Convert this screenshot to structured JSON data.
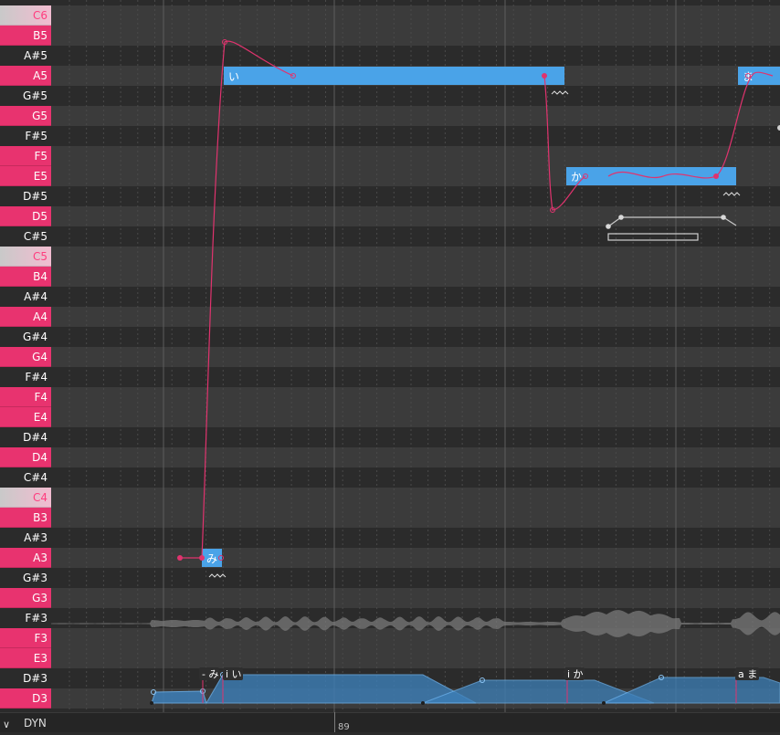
{
  "piano_keys": [
    {
      "label": "C6",
      "kind": "cnote"
    },
    {
      "label": "B5",
      "kind": "white"
    },
    {
      "label": "A#5",
      "kind": "black"
    },
    {
      "label": "A5",
      "kind": "white"
    },
    {
      "label": "G#5",
      "kind": "black"
    },
    {
      "label": "G5",
      "kind": "white"
    },
    {
      "label": "F#5",
      "kind": "black"
    },
    {
      "label": "F5",
      "kind": "white"
    },
    {
      "label": "E5",
      "kind": "white"
    },
    {
      "label": "D#5",
      "kind": "black"
    },
    {
      "label": "D5",
      "kind": "white"
    },
    {
      "label": "C#5",
      "kind": "black"
    },
    {
      "label": "C5",
      "kind": "cnote"
    },
    {
      "label": "B4",
      "kind": "white"
    },
    {
      "label": "A#4",
      "kind": "black"
    },
    {
      "label": "A4",
      "kind": "white"
    },
    {
      "label": "G#4",
      "kind": "black"
    },
    {
      "label": "G4",
      "kind": "white"
    },
    {
      "label": "F#4",
      "kind": "black"
    },
    {
      "label": "F4",
      "kind": "white"
    },
    {
      "label": "E4",
      "kind": "white"
    },
    {
      "label": "D#4",
      "kind": "black"
    },
    {
      "label": "D4",
      "kind": "white"
    },
    {
      "label": "C#4",
      "kind": "black"
    },
    {
      "label": "C4",
      "kind": "cnote"
    },
    {
      "label": "B3",
      "kind": "white"
    },
    {
      "label": "A#3",
      "kind": "black"
    },
    {
      "label": "A3",
      "kind": "white"
    },
    {
      "label": "G#3",
      "kind": "black"
    },
    {
      "label": "G3",
      "kind": "white"
    },
    {
      "label": "F#3",
      "kind": "black"
    },
    {
      "label": "F3",
      "kind": "white"
    },
    {
      "label": "E3",
      "kind": "white"
    },
    {
      "label": "D#3",
      "kind": "black"
    },
    {
      "label": "D3",
      "kind": "white"
    }
  ],
  "notes": [
    {
      "lyric": "み",
      "pitch": "A3"
    },
    {
      "lyric": "い",
      "pitch": "A5"
    },
    {
      "lyric": "か",
      "pitch": "E5"
    },
    {
      "lyric": "ま",
      "pitch": "A5"
    }
  ],
  "phonemes": [
    {
      "text": "- み"
    },
    {
      "text": "i い"
    },
    {
      "text": "i か"
    },
    {
      "text": "a ま"
    }
  ],
  "footer": {
    "expand_icon": "chevron-down-icon",
    "dyn_label": "DYN",
    "measure_number": "89"
  },
  "colors": {
    "note_fill": "#4aa3e8",
    "pitch_curve": "#e0336e",
    "key_white": "#e8336f",
    "row_light": "#3b3b3b",
    "row_dark": "#2b2b2b"
  }
}
